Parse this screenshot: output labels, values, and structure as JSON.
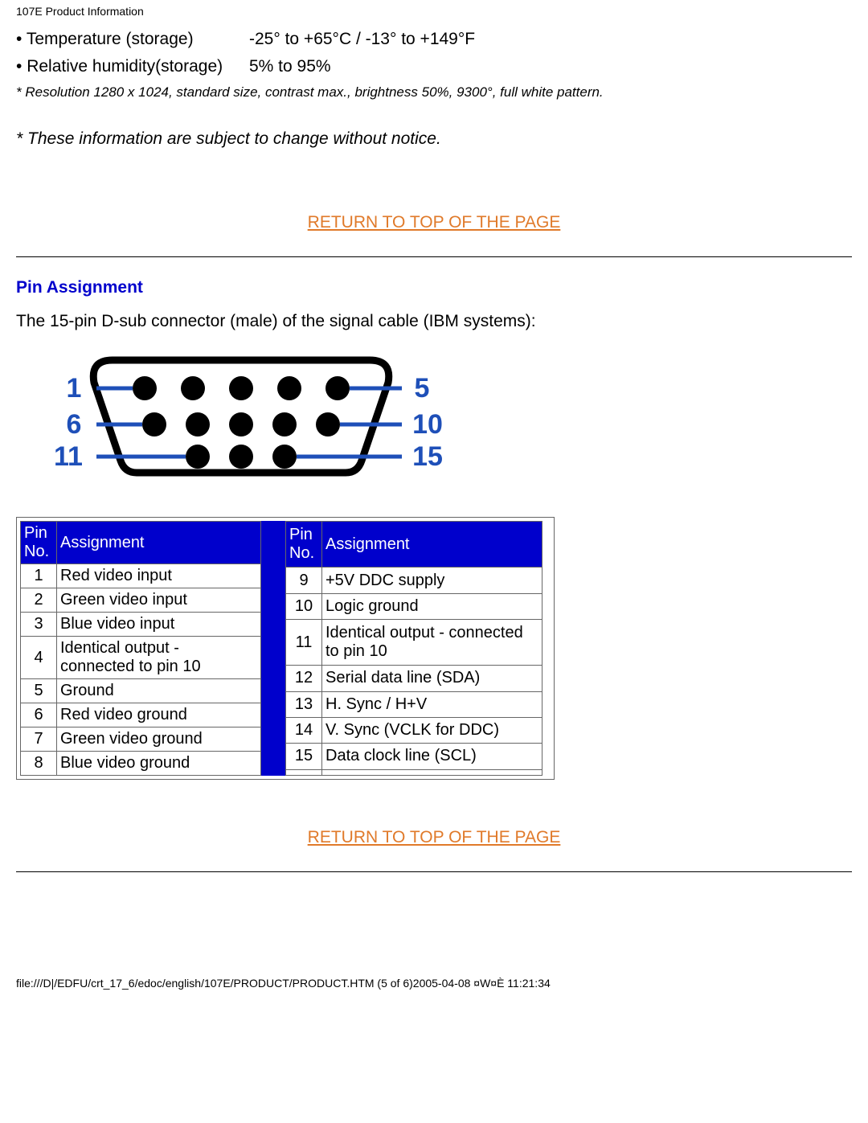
{
  "header": "107E Product Information",
  "specs": [
    {
      "label": "Temperature (storage)",
      "value": "-25° to +65°C / -13° to +149°F"
    },
    {
      "label": "Relative humidity(storage)",
      "value": "5% to 95%"
    }
  ],
  "footnote1": "* Resolution 1280 x 1024, standard size, contrast max., brightness 50%, 9300°, full white pattern.",
  "footnote2": "* These information are subject to change without notice.",
  "return_link": "RETURN TO TOP OF THE PAGE",
  "pin_section": {
    "heading": "Pin Assignment",
    "text": "The 15-pin D-sub connector (male) of the signal cable (IBM systems):",
    "diagram_labels": {
      "r1s": "1",
      "r1e": "5",
      "r2s": "6",
      "r2e": "10",
      "r3s": "11",
      "r3e": "15"
    },
    "col_headers": {
      "pin": "Pin No.",
      "assign": "Assignment"
    },
    "left": [
      {
        "no": "1",
        "a": "Red video input"
      },
      {
        "no": "2",
        "a": "Green video input"
      },
      {
        "no": "3",
        "a": "Blue video input"
      },
      {
        "no": "4",
        "a": "Identical output - connected to pin 10"
      },
      {
        "no": "5",
        "a": "Ground"
      },
      {
        "no": "6",
        "a": "Red video ground"
      },
      {
        "no": "7",
        "a": "Green video ground"
      },
      {
        "no": "8",
        "a": "Blue video ground"
      }
    ],
    "right": [
      {
        "no": "9",
        "a": "+5V DDC supply"
      },
      {
        "no": "10",
        "a": "Logic ground"
      },
      {
        "no": "11",
        "a": "Identical output - connected to pin 10"
      },
      {
        "no": "12",
        "a": "Serial data line (SDA)"
      },
      {
        "no": "13",
        "a": "H. Sync / H+V"
      },
      {
        "no": "14",
        "a": "V. Sync (VCLK for DDC)"
      },
      {
        "no": "15",
        "a": "Data clock line (SCL)"
      },
      {
        "no": "",
        "a": ""
      }
    ]
  },
  "footer": "file:///D|/EDFU/crt_17_6/edoc/english/107E/PRODUCT/PRODUCT.HTM (5 of 6)2005-04-08 ¤W¤È 11:21:34"
}
